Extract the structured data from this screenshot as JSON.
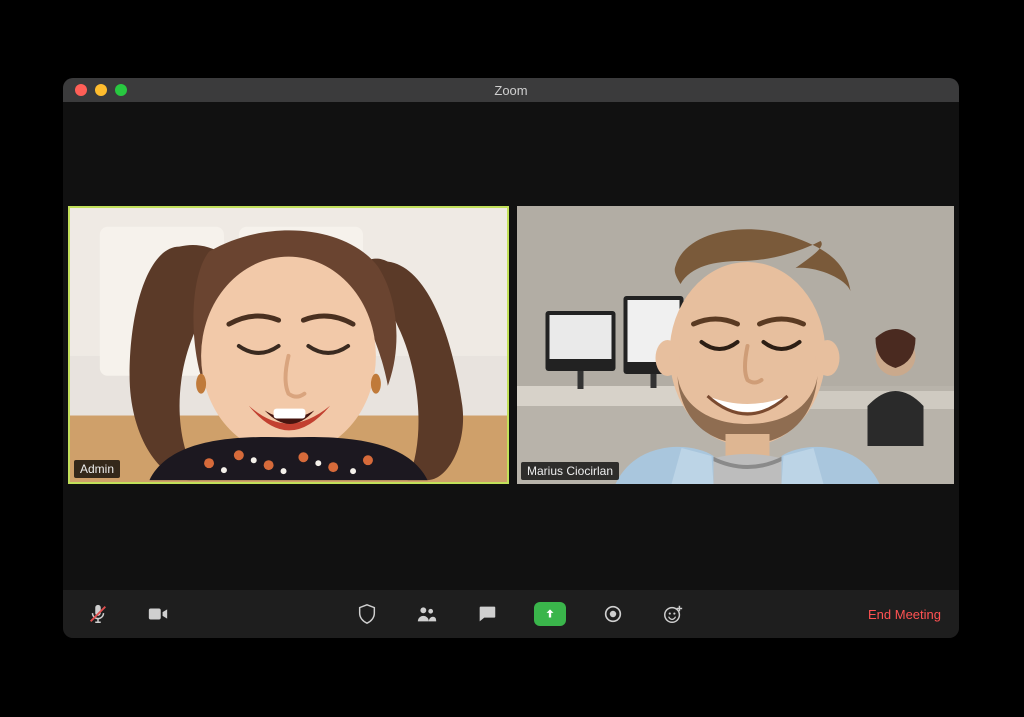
{
  "window": {
    "title": "Zoom"
  },
  "participants": [
    {
      "label": "Admin",
      "active": true
    },
    {
      "label": "Marius Ciocirlan",
      "active": false
    }
  ],
  "toolbar": {
    "mute_icon": "microphone-muted-icon",
    "video_icon": "video-icon",
    "security_icon": "shield-icon",
    "participants_icon": "participants-icon",
    "chat_icon": "chat-icon",
    "share_icon": "share-screen-icon",
    "record_icon": "record-icon",
    "reactions_icon": "reactions-icon",
    "end_label": "End Meeting"
  }
}
